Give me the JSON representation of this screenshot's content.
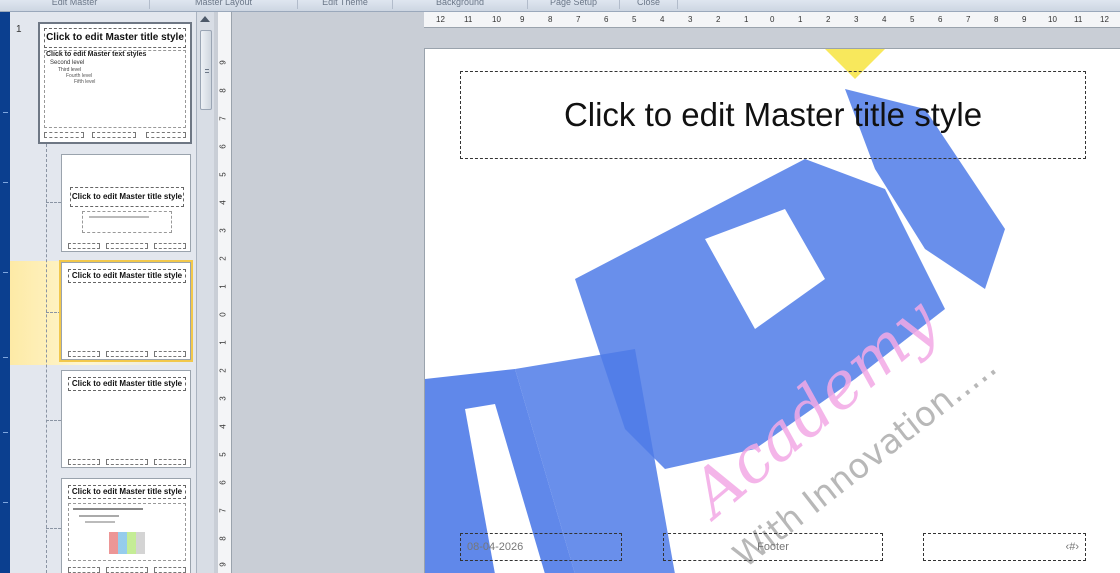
{
  "ribbon": {
    "groups": [
      "Edit Master",
      "Master Layout",
      "Edit Theme",
      "Background",
      "Page Setup",
      "Close"
    ]
  },
  "thumbnails": {
    "master_number": "1",
    "master_title": "Click to edit Master title style",
    "master_body": [
      "Click to edit Master text styles",
      "Second level",
      "Third level",
      "Fourth level",
      "Fifth level"
    ],
    "layout_title": "Click to edit Master title style"
  },
  "rulers": {
    "horizontal": [
      "12",
      "11",
      "10",
      "9",
      "8",
      "7",
      "6",
      "5",
      "4",
      "3",
      "2",
      "1",
      "0",
      "1",
      "2",
      "3",
      "4",
      "5",
      "6",
      "7",
      "8",
      "9",
      "10",
      "11",
      "12"
    ],
    "vertical": [
      "9",
      "8",
      "7",
      "6",
      "5",
      "4",
      "3",
      "2",
      "1",
      "0",
      "1",
      "2",
      "3",
      "4",
      "5",
      "6",
      "7",
      "8",
      "9"
    ]
  },
  "slide": {
    "title": "Click to edit Master title style",
    "date": "08-04-2026",
    "footer": "Footer",
    "slide_number": "‹#›"
  },
  "watermark": {
    "script_text": "Academy",
    "tagline": "With Innovation.....",
    "colors": {
      "blue": "#4f7be8",
      "pink": "#f3a9e6",
      "yellow": "#f7e64a",
      "gray": "#c7c7c7"
    }
  },
  "colors": {
    "left_edge": "#0b3f8f",
    "selected_highlight": "#fdeaa6"
  }
}
